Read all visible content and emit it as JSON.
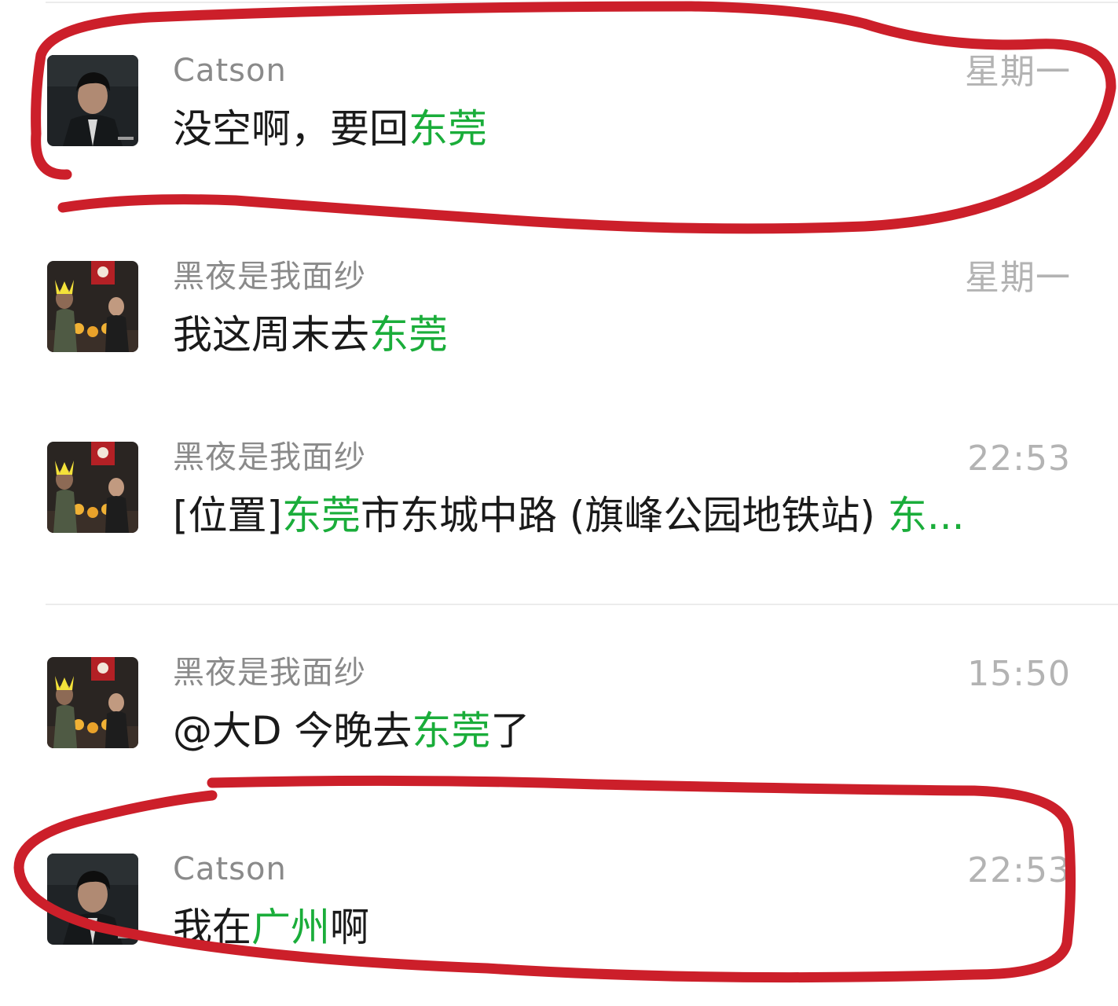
{
  "results": [
    {
      "name": "Catson",
      "time": "星期一",
      "message_parts": [
        {
          "text": "没空啊，要回",
          "highlight": false
        },
        {
          "text": "东莞",
          "highlight": true
        }
      ]
    },
    {
      "name": "黑夜是我面纱",
      "time": "星期一",
      "message_parts": [
        {
          "text": "我这周末去",
          "highlight": false
        },
        {
          "text": "东莞",
          "highlight": true
        }
      ]
    },
    {
      "name": "黑夜是我面纱",
      "time": "22:53",
      "message_parts": [
        {
          "text": "[位置]",
          "highlight": false
        },
        {
          "text": "东莞",
          "highlight": true
        },
        {
          "text": "市东城中路 (旗峰公园地铁站) ",
          "highlight": false
        },
        {
          "text": "东...",
          "highlight": true
        }
      ]
    },
    {
      "name": "黑夜是我面纱",
      "time": "15:50",
      "message_parts": [
        {
          "text": "@大D 今晚去",
          "highlight": false
        },
        {
          "text": "东莞",
          "highlight": true
        },
        {
          "text": "了",
          "highlight": false
        }
      ]
    },
    {
      "name": "Catson",
      "time": "22:53",
      "message_parts": [
        {
          "text": "我在",
          "highlight": false
        },
        {
          "text": "广州",
          "highlight": true
        },
        {
          "text": "啊",
          "highlight": false
        }
      ]
    }
  ],
  "colors": {
    "highlight": "#1aad3a",
    "annotation": "#cc1f2a",
    "name": "#8a8a8a",
    "time": "#b3b3b3"
  },
  "icons": {
    "catson_avatar": "man-in-dark-suit-avatar",
    "group_avatar": "kfc-party-group-avatar"
  }
}
